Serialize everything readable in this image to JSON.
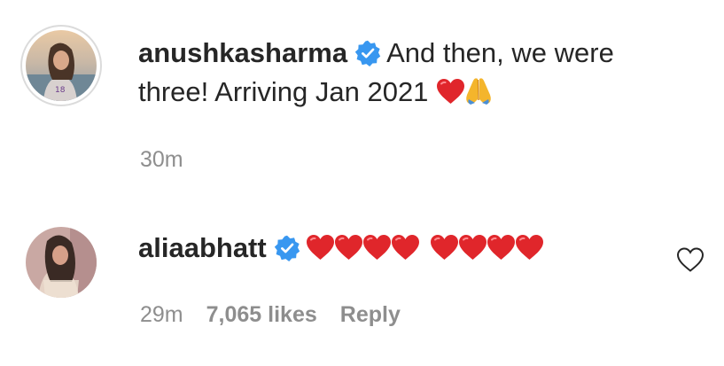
{
  "comments": [
    {
      "username": "anushkasharma",
      "verified": true,
      "text_line1": "And then, we were",
      "text_line2": "three! Arriving Jan 2021",
      "emojis": [
        "red-heart",
        "folded-hands"
      ],
      "time": "30m"
    },
    {
      "username": "aliaabhatt",
      "verified": true,
      "emojis": [
        "red-heart",
        "red-heart",
        "red-heart",
        "red-heart",
        "space",
        "red-heart",
        "red-heart",
        "red-heart",
        "red-heart"
      ],
      "time": "29m",
      "likes": "7,065 likes",
      "reply_label": "Reply"
    }
  ],
  "colors": {
    "text": "#262626",
    "meta": "#8e8e8e",
    "verified": "#3897f0",
    "heart": "#e0262b"
  }
}
